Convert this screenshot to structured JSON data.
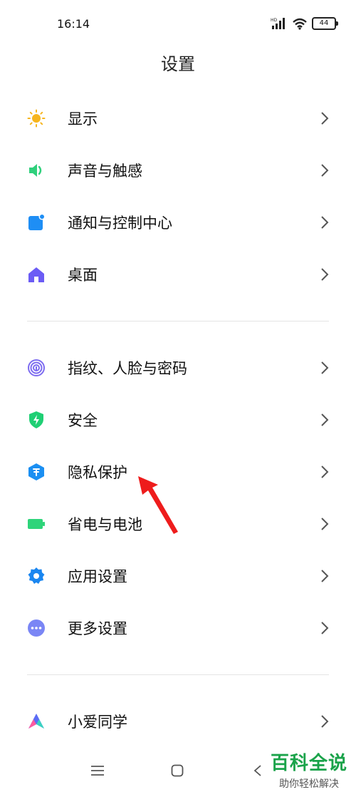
{
  "status_bar": {
    "time": "16:14",
    "hd_label": "HD",
    "battery_level": "44",
    "icons": [
      "signal-icon",
      "wifi-icon",
      "battery-icon"
    ]
  },
  "header": {
    "title": "设置"
  },
  "groups": [
    {
      "items": [
        {
          "label": "显示",
          "icon": "sun-icon",
          "color": "#f6b51e"
        },
        {
          "label": "声音与触感",
          "icon": "speaker-icon",
          "color": "#2fd07c"
        },
        {
          "label": "通知与控制中心",
          "icon": "notification-icon",
          "color": "#1e8ef5"
        },
        {
          "label": "桌面",
          "icon": "home-icon",
          "color": "#6b5cf5"
        }
      ]
    },
    {
      "items": [
        {
          "label": "指纹、人脸与密码",
          "icon": "fingerprint-icon",
          "color": "#7d6cf0"
        },
        {
          "label": "安全",
          "icon": "shield-icon",
          "color": "#1fcf74"
        },
        {
          "label": "隐私保护",
          "icon": "privacy-icon",
          "color": "#1b8ff2"
        },
        {
          "label": "省电与电池",
          "icon": "battery-saver-icon",
          "color": "#2ed47a"
        },
        {
          "label": "应用设置",
          "icon": "gear-icon",
          "color": "#1a86f0"
        },
        {
          "label": "更多设置",
          "icon": "more-icon",
          "color": "#7a86f5"
        }
      ]
    },
    {
      "items": [
        {
          "label": "小爱同学",
          "icon": "xiaoai-icon",
          "color": "#5b6cf5"
        }
      ]
    }
  ],
  "nav_bar": {
    "icons": [
      "menu-icon",
      "home-square-icon",
      "back-icon"
    ]
  },
  "watermark": {
    "title": "百科全说",
    "subtitle": "助你轻松解决"
  },
  "annotation": {
    "arrow_color": "#ee1c1c"
  }
}
